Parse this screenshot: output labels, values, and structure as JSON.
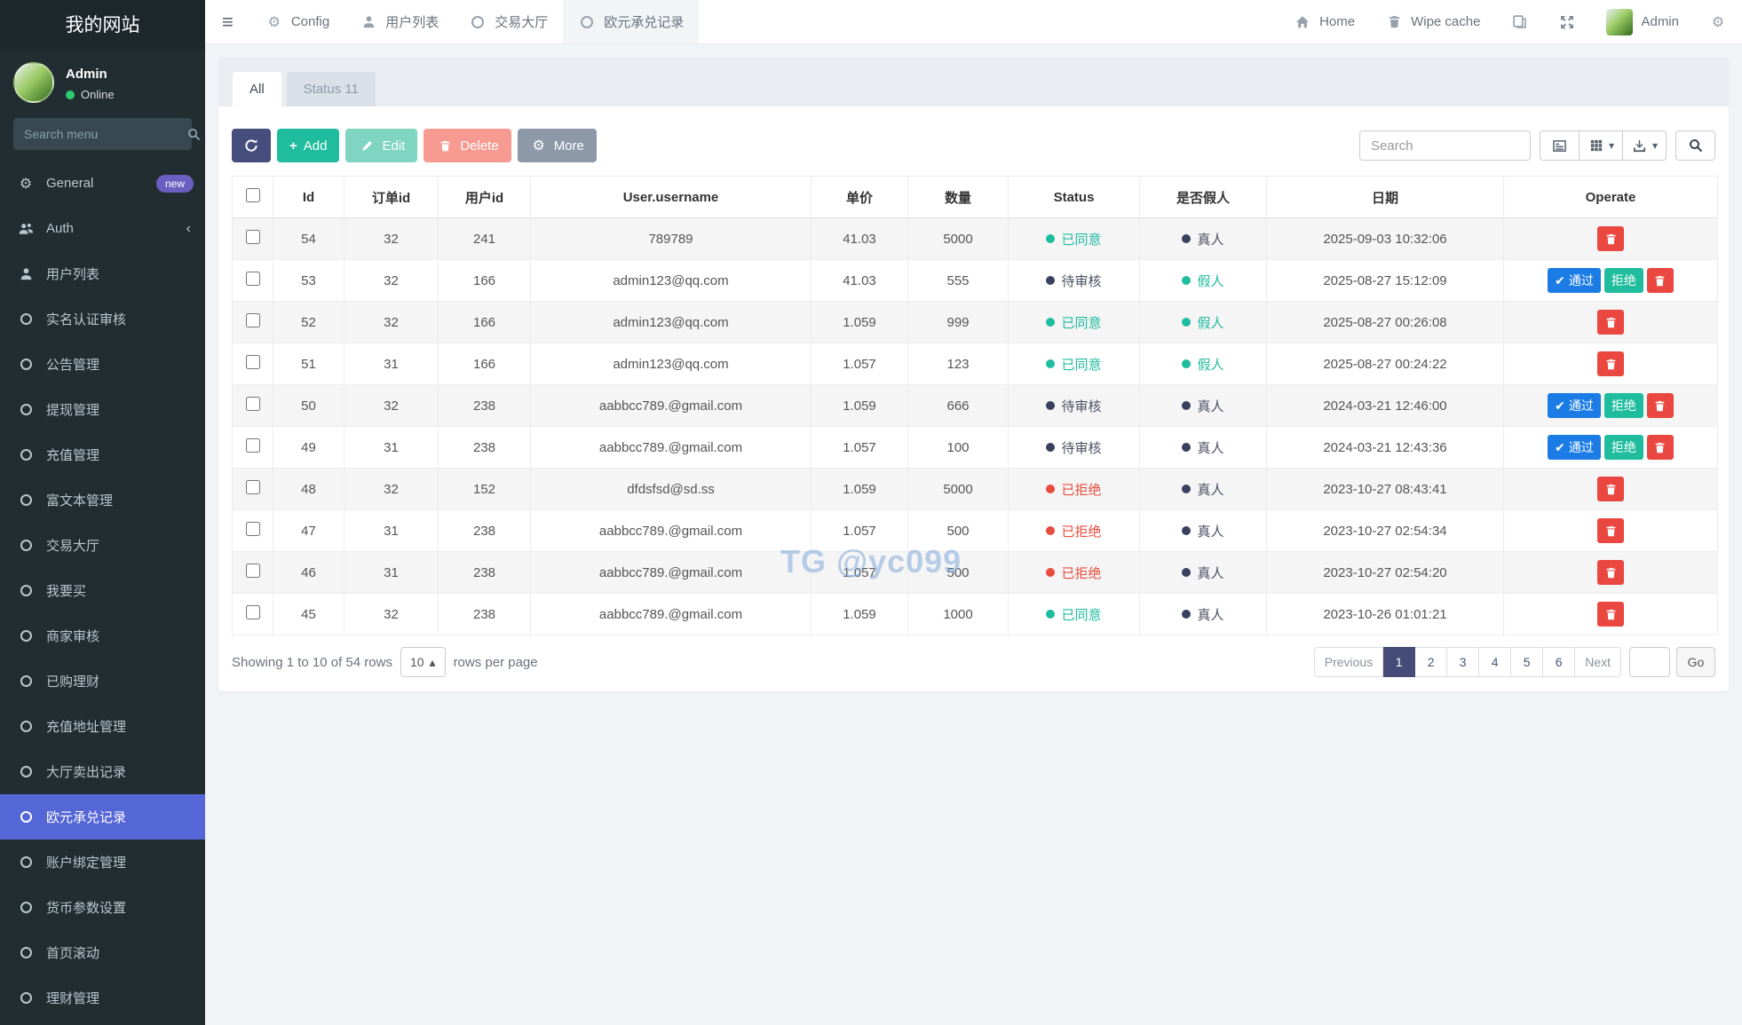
{
  "brand": {
    "title": "我的网站"
  },
  "user_panel": {
    "name": "Admin",
    "status": "Online"
  },
  "icons": {
    "gear": "⚙",
    "hamburger": "≡",
    "caret_down": "▾",
    "caret_up": "▴",
    "check": "✔",
    "chevron_left": "‹",
    "plus": "+"
  },
  "sidebar": {
    "search_placeholder": "Search menu",
    "items": [
      {
        "label": "General",
        "icon": "gears-icon",
        "badge": "new"
      },
      {
        "label": "Auth",
        "icon": "group-icon",
        "chevron": true
      },
      {
        "label": "用户列表",
        "icon": "user-icon"
      },
      {
        "label": "实名认证审核",
        "icon": "circle-icon"
      },
      {
        "label": "公告管理",
        "icon": "circle-icon"
      },
      {
        "label": "提现管理",
        "icon": "circle-icon"
      },
      {
        "label": "充值管理",
        "icon": "circle-icon"
      },
      {
        "label": "富文本管理",
        "icon": "circle-icon"
      },
      {
        "label": "交易大厅",
        "icon": "circle-icon"
      },
      {
        "label": "我要买",
        "icon": "circle-icon"
      },
      {
        "label": "商家审核",
        "icon": "circle-icon"
      },
      {
        "label": "已购理财",
        "icon": "circle-icon"
      },
      {
        "label": "充值地址管理",
        "icon": "circle-icon"
      },
      {
        "label": "大厅卖出记录",
        "icon": "circle-icon"
      },
      {
        "label": "欧元承兑记录",
        "icon": "circle-icon",
        "active": true
      },
      {
        "label": "账户绑定管理",
        "icon": "circle-icon"
      },
      {
        "label": "货币参数设置",
        "icon": "circle-icon"
      },
      {
        "label": "首页滚动",
        "icon": "circle-icon"
      },
      {
        "label": "理财管理",
        "icon": "circle-icon"
      }
    ]
  },
  "topnav": {
    "left": [
      {
        "label": "Config",
        "icon": "gear-icon"
      },
      {
        "label": "用户列表",
        "icon": "user-icon"
      },
      {
        "label": "交易大厅",
        "icon": "circle-icon"
      },
      {
        "label": "欧元承兑记录",
        "icon": "circle-icon",
        "active": true
      }
    ],
    "home": "Home",
    "wipe_cache": "Wipe cache",
    "admin": "Admin"
  },
  "tabs": {
    "all": "All",
    "status": "Status 11"
  },
  "toolbar": {
    "add_label": "Add",
    "edit_label": "Edit",
    "delete_label": "Delete",
    "more_label": "More",
    "search_placeholder": "Search"
  },
  "table": {
    "columns": [
      "Id",
      "订单id",
      "用户id",
      "User.username",
      "单价",
      "数量",
      "Status",
      "是否假人",
      "日期",
      "Operate"
    ],
    "action_labels": {
      "approve": "通过",
      "reject": "拒绝"
    },
    "rows": [
      {
        "id": "54",
        "order_id": "32",
        "user_id": "241",
        "username": "789789",
        "price": "41.03",
        "amount": "5000",
        "status": "已同意",
        "status_type": "approved",
        "fake": "真人",
        "fake_type": "real",
        "date": "2025-09-03 10:32:06",
        "actions": [
          "delete"
        ]
      },
      {
        "id": "53",
        "order_id": "32",
        "user_id": "166",
        "username": "admin123@qq.com",
        "price": "41.03",
        "amount": "555",
        "status": "待审核",
        "status_type": "pending",
        "fake": "假人",
        "fake_type": "fake",
        "date": "2025-08-27 15:12:09",
        "actions": [
          "approve",
          "reject",
          "delete"
        ]
      },
      {
        "id": "52",
        "order_id": "32",
        "user_id": "166",
        "username": "admin123@qq.com",
        "price": "1.059",
        "amount": "999",
        "status": "已同意",
        "status_type": "approved",
        "fake": "假人",
        "fake_type": "fake",
        "date": "2025-08-27 00:26:08",
        "actions": [
          "delete"
        ]
      },
      {
        "id": "51",
        "order_id": "31",
        "user_id": "166",
        "username": "admin123@qq.com",
        "price": "1.057",
        "amount": "123",
        "status": "已同意",
        "status_type": "approved",
        "fake": "假人",
        "fake_type": "fake",
        "date": "2025-08-27 00:24:22",
        "actions": [
          "delete"
        ]
      },
      {
        "id": "50",
        "order_id": "32",
        "user_id": "238",
        "username": "aabbcc789.@gmail.com",
        "price": "1.059",
        "amount": "666",
        "status": "待审核",
        "status_type": "pending",
        "fake": "真人",
        "fake_type": "real",
        "date": "2024-03-21 12:46:00",
        "actions": [
          "approve",
          "reject",
          "delete"
        ]
      },
      {
        "id": "49",
        "order_id": "31",
        "user_id": "238",
        "username": "aabbcc789.@gmail.com",
        "price": "1.057",
        "amount": "100",
        "status": "待审核",
        "status_type": "pending",
        "fake": "真人",
        "fake_type": "real",
        "date": "2024-03-21 12:43:36",
        "actions": [
          "approve",
          "reject",
          "delete"
        ]
      },
      {
        "id": "48",
        "order_id": "32",
        "user_id": "152",
        "username": "dfdsfsd@sd.ss",
        "price": "1.059",
        "amount": "5000",
        "status": "已拒绝",
        "status_type": "rejected",
        "fake": "真人",
        "fake_type": "real",
        "date": "2023-10-27 08:43:41",
        "actions": [
          "delete"
        ]
      },
      {
        "id": "47",
        "order_id": "31",
        "user_id": "238",
        "username": "aabbcc789.@gmail.com",
        "price": "1.057",
        "amount": "500",
        "status": "已拒绝",
        "status_type": "rejected",
        "fake": "真人",
        "fake_type": "real",
        "date": "2023-10-27 02:54:34",
        "actions": [
          "delete"
        ]
      },
      {
        "id": "46",
        "order_id": "31",
        "user_id": "238",
        "username": "aabbcc789.@gmail.com",
        "price": "1.057",
        "amount": "500",
        "status": "已拒绝",
        "status_type": "rejected",
        "fake": "真人",
        "fake_type": "real",
        "date": "2023-10-27 02:54:20",
        "actions": [
          "delete"
        ]
      },
      {
        "id": "45",
        "order_id": "32",
        "user_id": "238",
        "username": "aabbcc789.@gmail.com",
        "price": "1.059",
        "amount": "1000",
        "status": "已同意",
        "status_type": "approved",
        "fake": "真人",
        "fake_type": "real",
        "date": "2023-10-26 01:01:21",
        "actions": [
          "delete"
        ]
      }
    ]
  },
  "footer": {
    "showing": "Showing 1 to 10 of 54 rows",
    "page_size": "10",
    "rows_per_page": "rows per page",
    "pagination": {
      "previous": "Previous",
      "pages": [
        "1",
        "2",
        "3",
        "4",
        "5",
        "6"
      ],
      "active_page": "1",
      "next": "Next",
      "go": "Go"
    }
  },
  "watermark": "TG @yc099",
  "colors": {
    "sidebar_bg": "#222d32",
    "sidebar_active": "#5566d6",
    "badge_purple": "#6a5fc1",
    "online_green": "#2ecc71",
    "primary_dark": "#444c77",
    "accent_green": "#1fbc9e",
    "approve_blue": "#1b7ce6",
    "danger_red": "#e9473f",
    "rejected_text": "#e74c3c",
    "pending_dark": "#39415f",
    "content_bg": "#f1f4f6"
  }
}
